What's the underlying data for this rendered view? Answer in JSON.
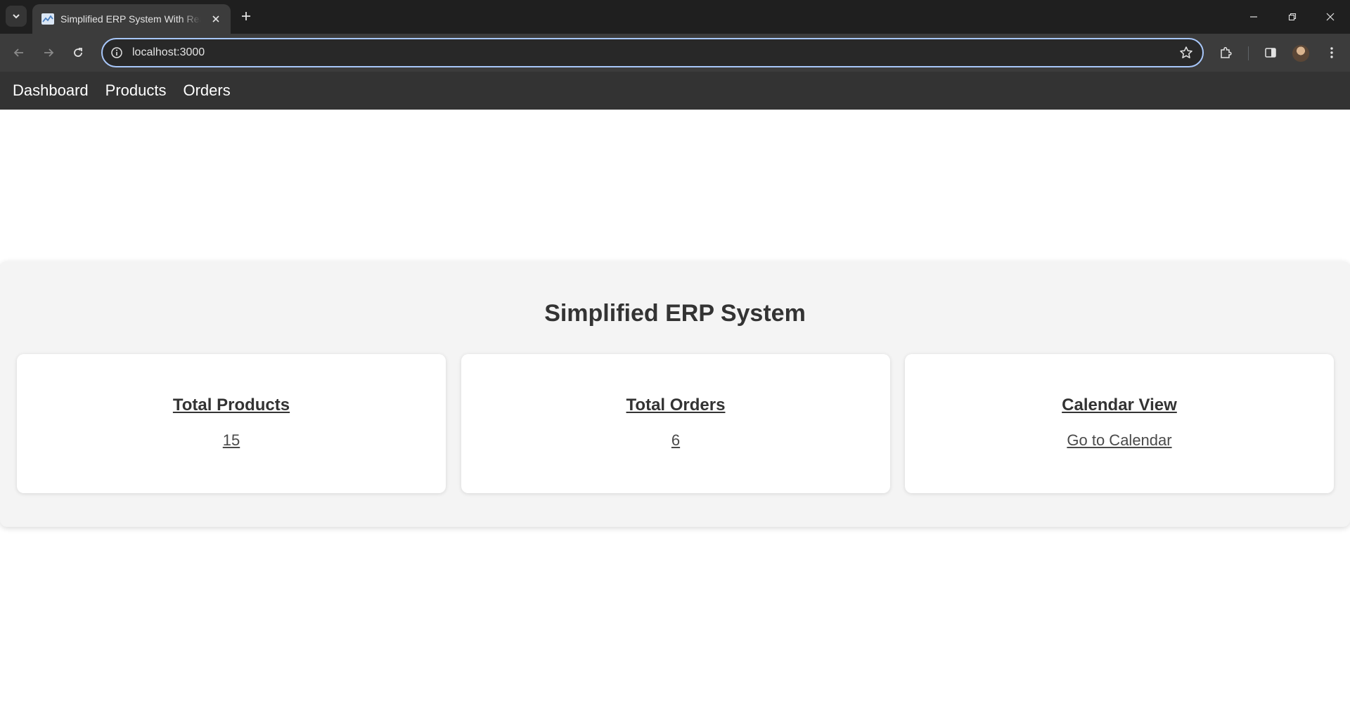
{
  "browser": {
    "tab_title": "Simplified ERP System With React",
    "url": "localhost:3000"
  },
  "nav": {
    "items": [
      {
        "label": "Dashboard"
      },
      {
        "label": "Products"
      },
      {
        "label": "Orders"
      }
    ]
  },
  "dashboard": {
    "title": "Simplified ERP System",
    "cards": [
      {
        "title": "Total Products",
        "value": "15"
      },
      {
        "title": "Total Orders",
        "value": "6"
      },
      {
        "title": "Calendar View",
        "value": "Go to Calendar"
      }
    ]
  },
  "colors": {
    "nav_background": "#333333",
    "dashboard_background": "#f4f4f4",
    "card_background": "#ffffff",
    "omnibox_focus": "#a8c7fa"
  }
}
